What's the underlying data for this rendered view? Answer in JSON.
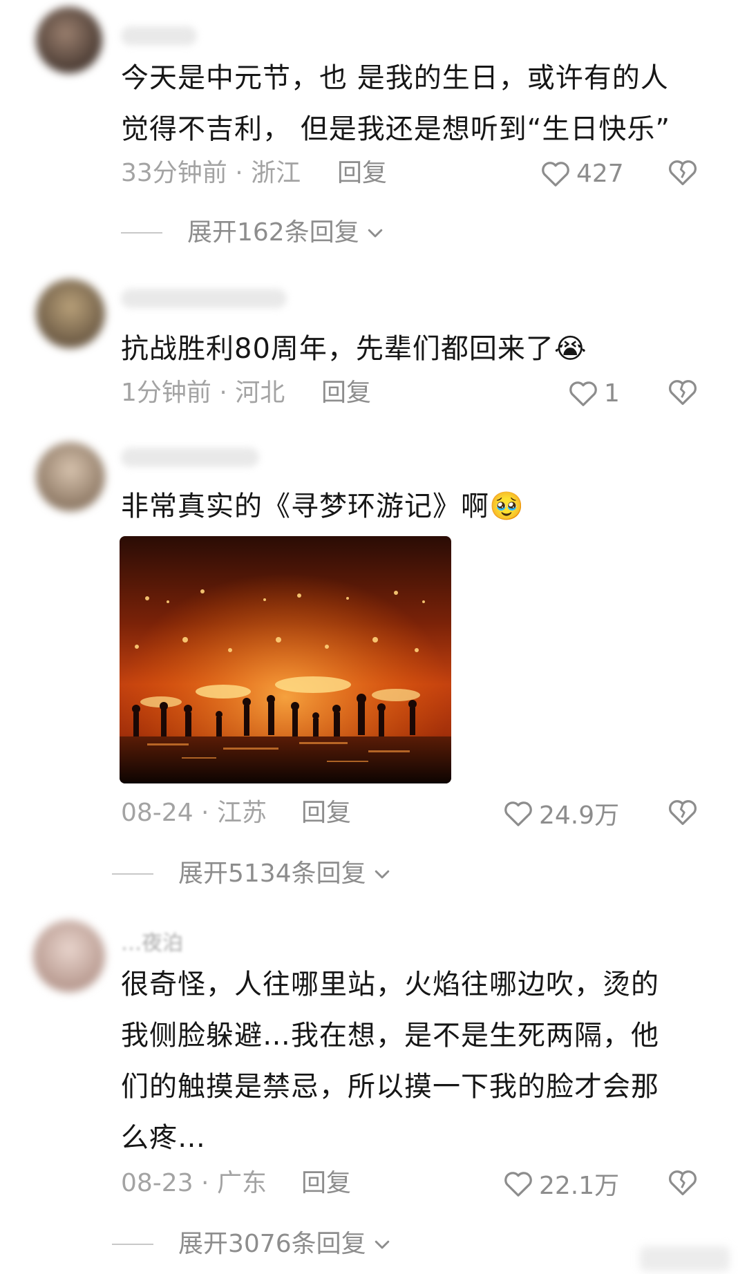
{
  "comments": [
    {
      "text_lines": [
        "今天是中元节，也 是我的生日，或许有的人",
        "觉得不吉利， 但是我还是想听到“生日快乐”"
      ],
      "meta": "33分钟前 · 浙江",
      "reply_label": "回复",
      "likes": "427",
      "expand_label": "展开162条回复"
    },
    {
      "text_lines": [
        "抗战胜利80周年，先辈们都回来了"
      ],
      "emoji": "😭",
      "meta": "1分钟前 · 河北",
      "reply_label": "回复",
      "likes": "1"
    },
    {
      "text_lines": [
        "非常真实的《寻梦环游记》啊"
      ],
      "emoji": "🥹",
      "meta": "08-24 · 江苏",
      "reply_label": "回复",
      "likes": "24.9万",
      "expand_label": "展开5134条回复"
    },
    {
      "username": "…夜泊",
      "text_lines": [
        "很奇怪，人往哪里站，火焰往哪边吹，烫的",
        "我侧脸躲避…我在想，是不是生死两隔，他",
        "们的触摸是禁忌，所以摸一下我的脸才会那",
        "么疼…"
      ],
      "meta": "08-23 · 广东",
      "reply_label": "回复",
      "likes": "22.1万",
      "expand_label": "展开3076条回复"
    }
  ],
  "icons": {
    "like": "heart-outline-icon",
    "dislike": "broken-heart-icon",
    "expand": "chevron-down-icon"
  },
  "colors": {
    "meta_gray": "#a3a3a3",
    "text": "#161616"
  }
}
